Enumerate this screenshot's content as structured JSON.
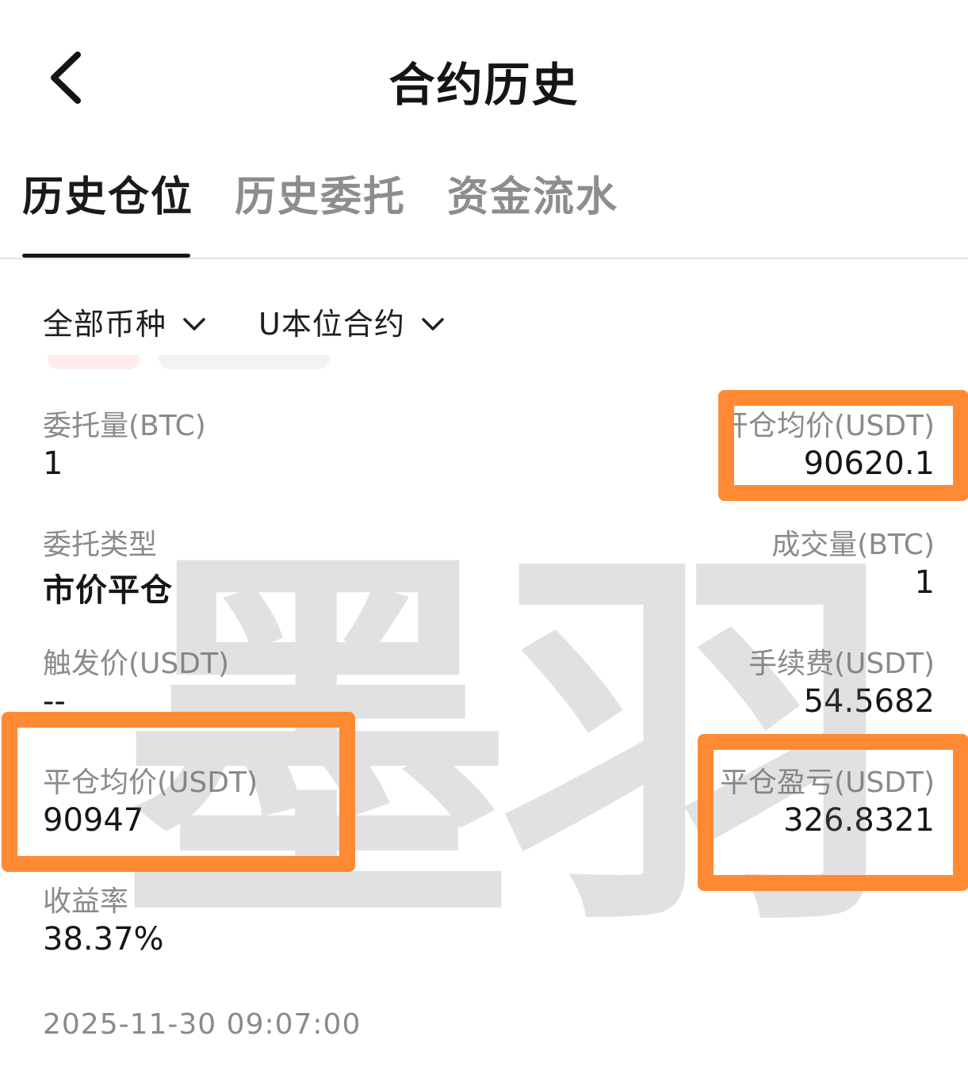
{
  "header": {
    "title": "合约历史",
    "back_icon": "chevron-left-icon"
  },
  "tabs": [
    {
      "label": "历史仓位",
      "active": true
    },
    {
      "label": "历史委托",
      "active": false
    },
    {
      "label": "资金流水",
      "active": false
    }
  ],
  "filters": {
    "coin": {
      "label": "全部币种",
      "icon": "chevron-down-icon"
    },
    "contract": {
      "label": "U本位合约",
      "icon": "chevron-down-icon"
    }
  },
  "record": {
    "order_qty": {
      "label": "委托量(BTC)",
      "value": "1"
    },
    "open_avg_price": {
      "label": "开仓均价(USDT)",
      "value": "90620.1"
    },
    "order_type": {
      "label": "委托类型",
      "value": "市价平仓"
    },
    "filled_qty": {
      "label": "成交量(BTC)",
      "value": "1"
    },
    "trigger_price": {
      "label": "触发价(USDT)",
      "value": "--"
    },
    "fee": {
      "label": "手续费(USDT)",
      "value": "54.5682"
    },
    "close_avg_price": {
      "label": "平仓均价(USDT)",
      "value": "90947"
    },
    "close_pnl": {
      "label": "平仓盈亏(USDT)",
      "value": "326.8321"
    },
    "yield_rate": {
      "label": "收益率",
      "value": "38.37%"
    },
    "timestamp": "2025-11-30 09:07:00"
  },
  "watermark": "墨羽",
  "colors": {
    "highlight": "#ff8a33",
    "text_primary": "#161616",
    "text_secondary": "#8a8a8a",
    "tab_inactive": "#8d8d8d"
  }
}
